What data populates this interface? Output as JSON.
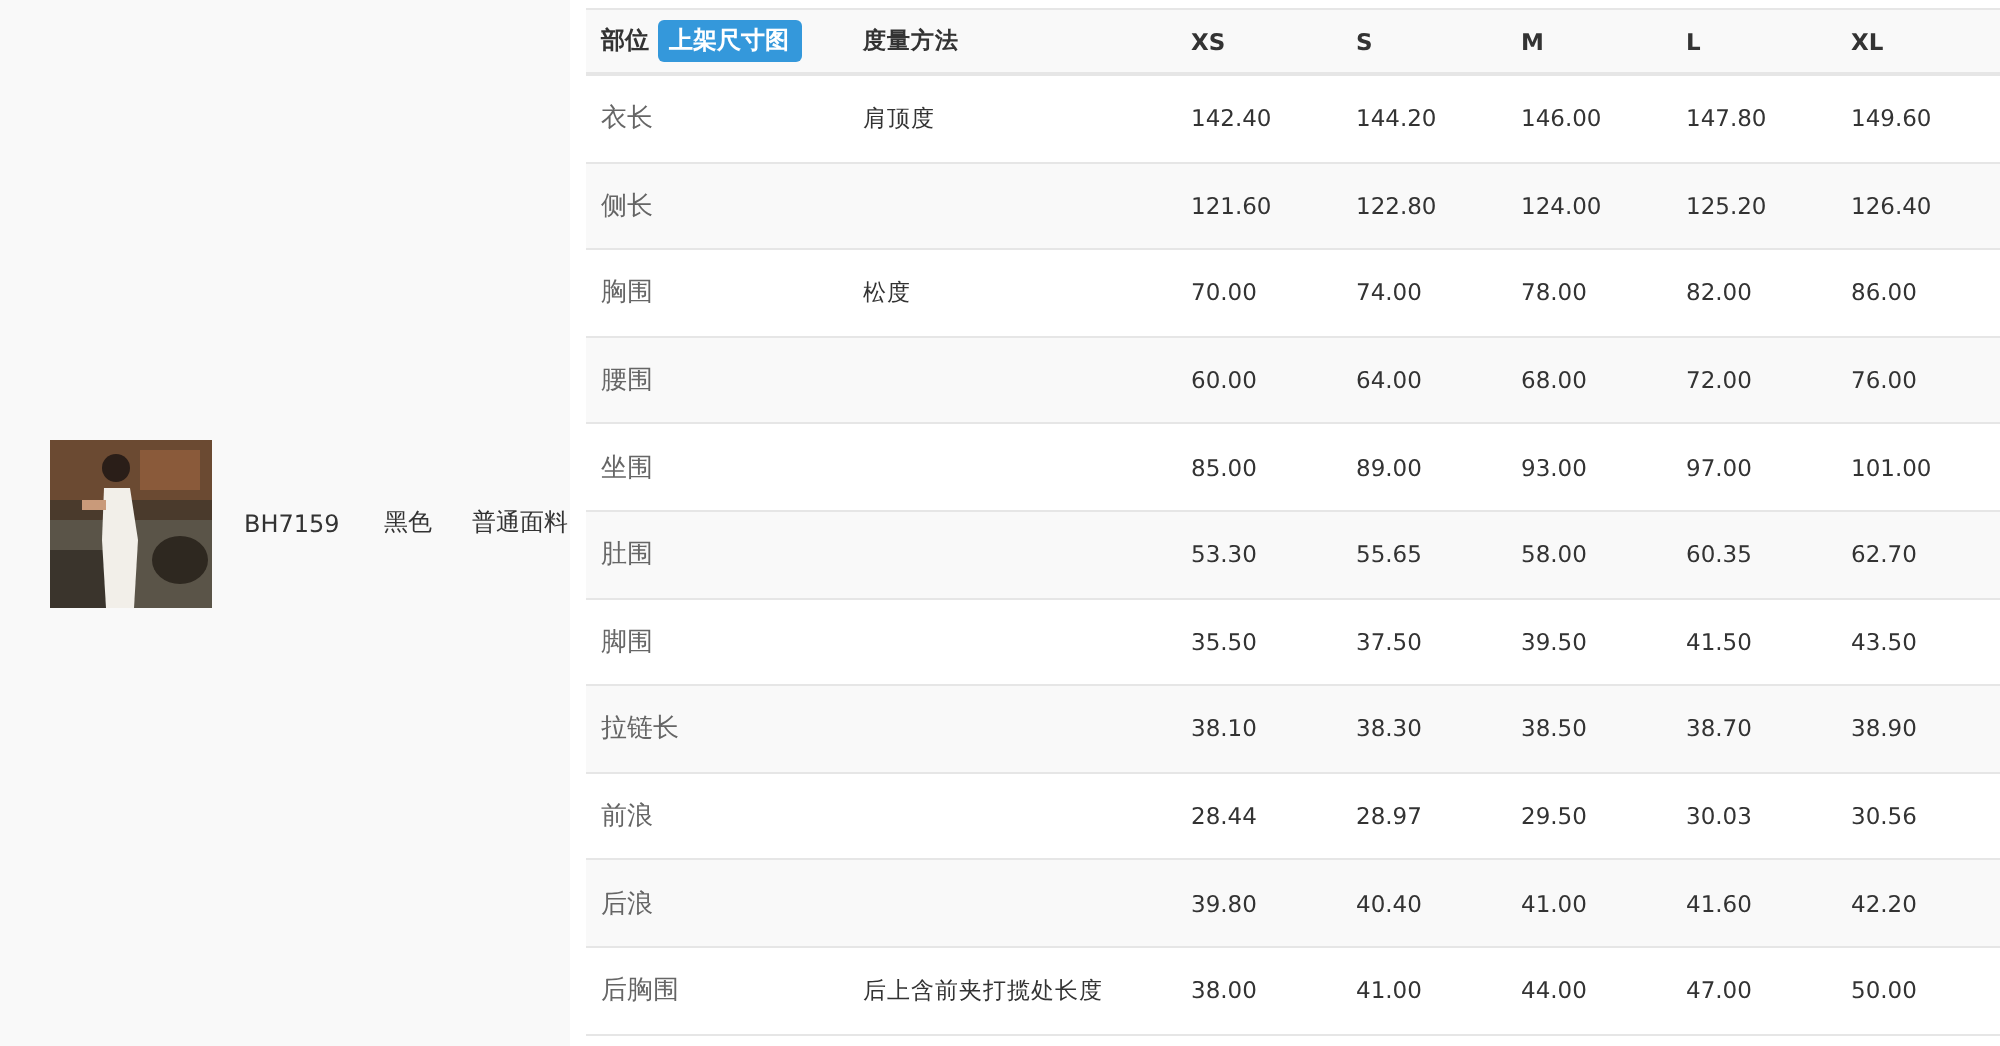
{
  "product": {
    "code": "BH7159",
    "color_name": "黑色",
    "fabric": "普通面料"
  },
  "table": {
    "columns": [
      "部位",
      "度量方法",
      "XS",
      "S",
      "M",
      "L",
      "XL"
    ],
    "header_button": "上架尺寸图",
    "rows": [
      {
        "part": "衣长",
        "method": "肩顶度",
        "values": [
          "142.40",
          "144.20",
          "146.00",
          "147.80",
          "149.60"
        ]
      },
      {
        "part": "侧长",
        "method": "",
        "values": [
          "121.60",
          "122.80",
          "124.00",
          "125.20",
          "126.40"
        ]
      },
      {
        "part": "胸围",
        "method": "松度",
        "values": [
          "70.00",
          "74.00",
          "78.00",
          "82.00",
          "86.00"
        ]
      },
      {
        "part": "腰围",
        "method": "",
        "values": [
          "60.00",
          "64.00",
          "68.00",
          "72.00",
          "76.00"
        ]
      },
      {
        "part": "坐围",
        "method": "",
        "values": [
          "85.00",
          "89.00",
          "93.00",
          "97.00",
          "101.00"
        ]
      },
      {
        "part": "肚围",
        "method": "",
        "values": [
          "53.30",
          "55.65",
          "58.00",
          "60.35",
          "62.70"
        ]
      },
      {
        "part": "脚围",
        "method": "",
        "values": [
          "35.50",
          "37.50",
          "39.50",
          "41.50",
          "43.50"
        ]
      },
      {
        "part": "拉链长",
        "method": "",
        "values": [
          "38.10",
          "38.30",
          "38.50",
          "38.70",
          "38.90"
        ]
      },
      {
        "part": "前浪",
        "method": "",
        "values": [
          "28.44",
          "28.97",
          "29.50",
          "30.03",
          "30.56"
        ]
      },
      {
        "part": "后浪",
        "method": "",
        "values": [
          "39.80",
          "40.40",
          "41.00",
          "41.60",
          "42.20"
        ]
      },
      {
        "part": "后胸围",
        "method": "后上含前夹打揽处长度",
        "values": [
          "38.00",
          "41.00",
          "44.00",
          "47.00",
          "50.00"
        ]
      }
    ]
  }
}
